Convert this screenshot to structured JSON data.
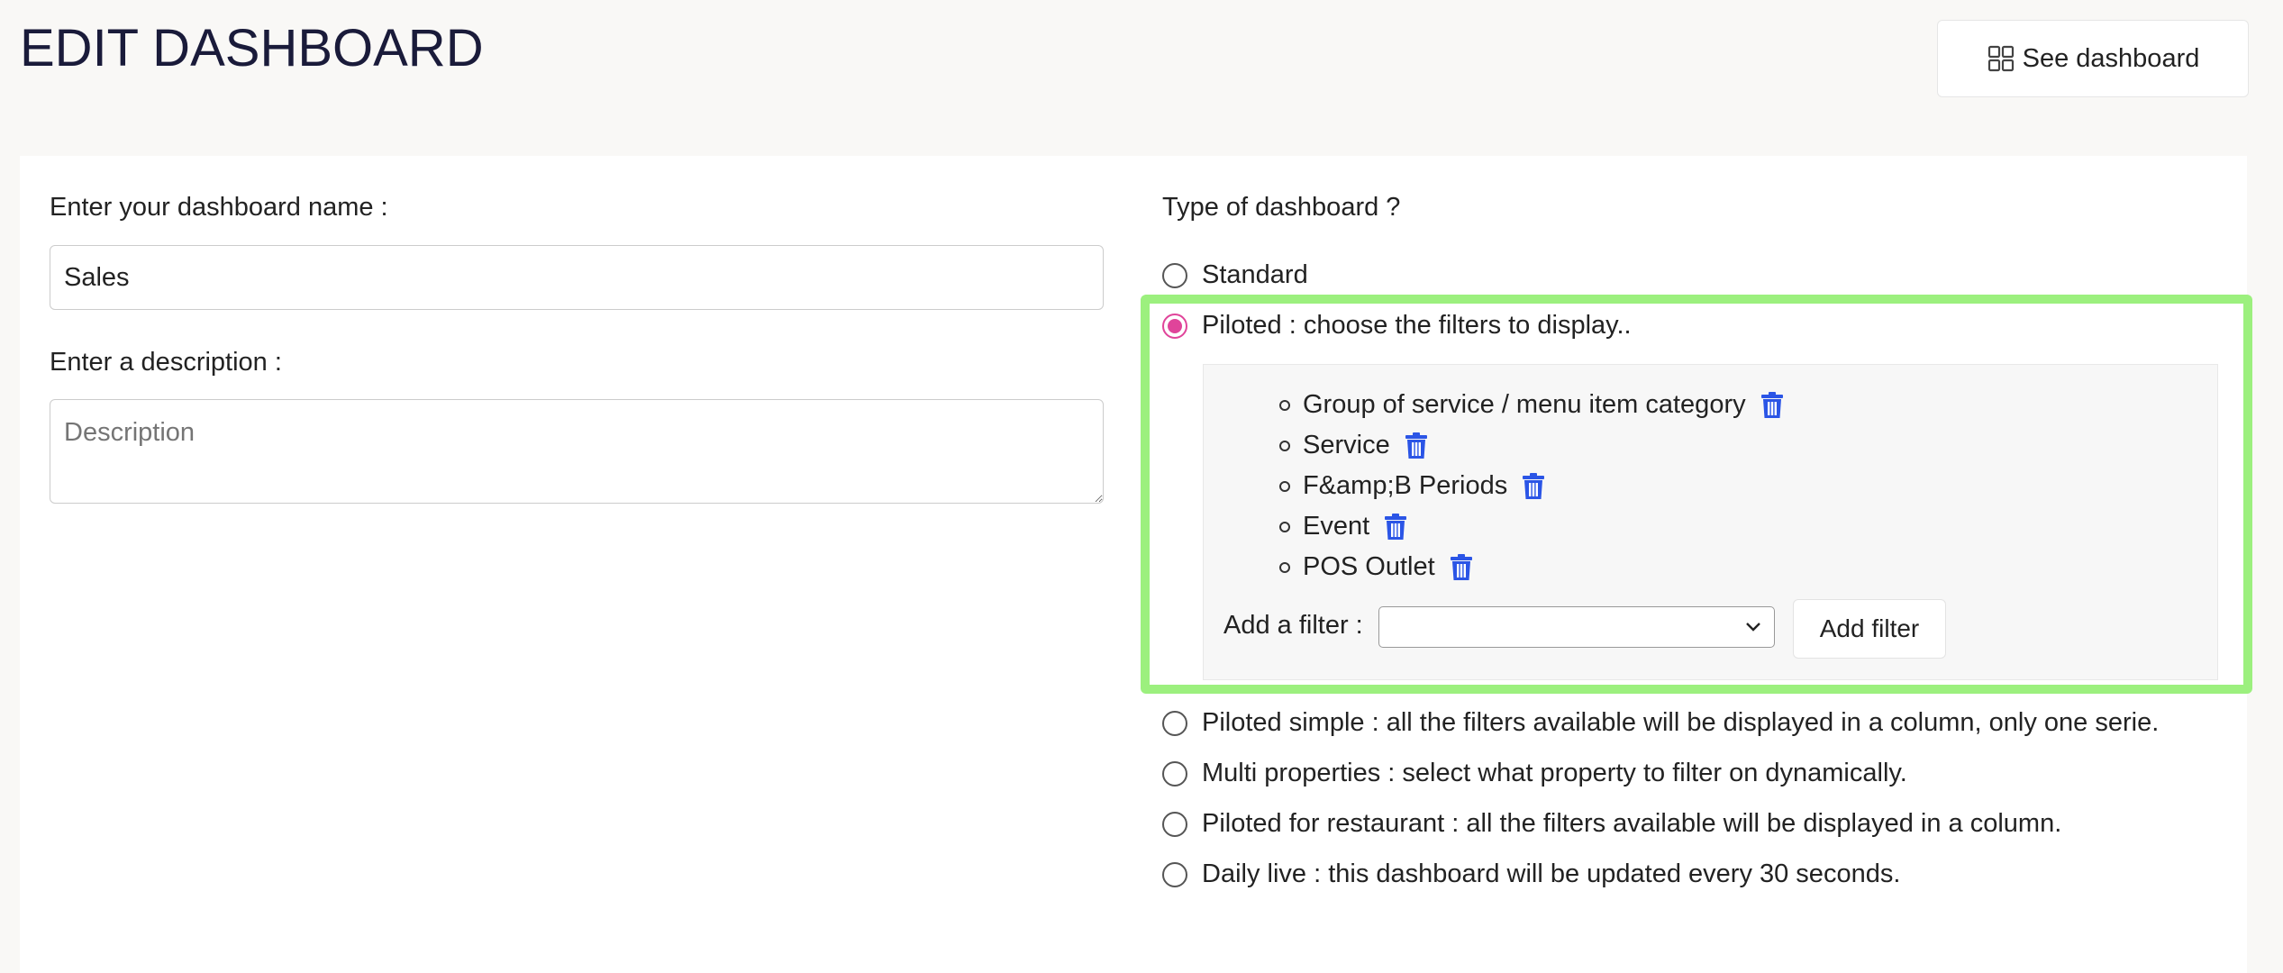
{
  "header": {
    "title": "EDIT DASHBOARD",
    "see_dashboard_label": "See dashboard",
    "see_dashboard_icon": "grid-icon"
  },
  "form": {
    "name_label": "Enter your dashboard name :",
    "name_value": "Sales",
    "description_label": "Enter a description :",
    "description_placeholder": "Description",
    "description_value": ""
  },
  "type": {
    "label": "Type of dashboard ?",
    "options": [
      {
        "label": "Standard",
        "checked": false
      },
      {
        "label": "Piloted : choose the filters to display..",
        "checked": true
      },
      {
        "label": "Piloted simple : all the filters available will be displayed in a column, only one serie.",
        "checked": false
      },
      {
        "label": "Multi properties : select what property to filter on dynamically.",
        "checked": false
      },
      {
        "label": "Piloted for restaurant : all the filters available will be displayed in a column.",
        "checked": false
      },
      {
        "label": "Daily live : this dashboard will be updated every 30 seconds.",
        "checked": false
      }
    ]
  },
  "filters": {
    "items": [
      {
        "label": "Group of service / menu item category"
      },
      {
        "label": "Service"
      },
      {
        "label": "F&amp;B Periods"
      },
      {
        "label": "Event"
      },
      {
        "label": "POS Outlet"
      }
    ],
    "add_label": "Add a filter :",
    "select_value": "",
    "add_button_label": "Add filter",
    "delete_icon": "trash-icon"
  },
  "colors": {
    "accent_radio": "#e0449a",
    "trash": "#2b55e6",
    "highlight": "#9cf07e",
    "title": "#1a1b3a"
  }
}
